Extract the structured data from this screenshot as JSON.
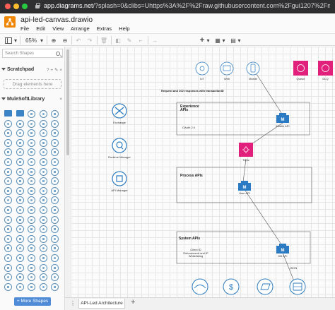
{
  "browser": {
    "url_host": "app.diagrams.net",
    "url_rest": "/?splash=0&clibs=Uhttps%3A%2F%2Fraw.githubusercontent.com%2Fgui1207%2Fmulesoft-draw.io%2Fmaster%2F"
  },
  "app": {
    "document_title": "api-led-canvas.drawio",
    "menu": [
      "File",
      "Edit",
      "View",
      "Arrange",
      "Extras",
      "Help"
    ]
  },
  "toolbar": {
    "zoom": "65%",
    "zoom_in": "⊕",
    "zoom_out": "⊖",
    "undo": "↶",
    "redo": "↷",
    "delete": "🗑",
    "fill": "◧",
    "line": "✎",
    "waypoints": "⌐",
    "connection": "→",
    "insert": "+",
    "table": "▦",
    "layout": "▤"
  },
  "sidebar": {
    "search_placeholder": "Search Shapes",
    "scratchpad_title": "Scratchpad",
    "scratchpad_controls": "? + ✎ ×",
    "drag_hint": "Drag elements here",
    "library_title": "MuleSoftLibrary",
    "library_controls": "×",
    "more_shapes": "+ More Shapes"
  },
  "pages": {
    "menu_glyph": "⋮",
    "active_page": "API-Led Architecture",
    "add_glyph": "+"
  },
  "diagram": {
    "top_icons": {
      "iot": "IoT",
      "web": "Web",
      "mobile": "Mobile",
      "queue": "Queue",
      "dlq": "DLQ"
    },
    "request_note": "Request and 202 responses with transactionID",
    "left_icons": {
      "exchange": "Exchange",
      "runtime_manager": "Runtime Manager",
      "api_manager": "API Manager"
    },
    "experience": {
      "title": "Experience APIs",
      "note": "OAuth 2.0",
      "api_label": "Mobile API"
    },
    "topic_label": "Topic",
    "process": {
      "title": "Process APIs",
      "api_label": "User API"
    },
    "system": {
      "title": "System APIs",
      "note": "Client ID Enforcement and IP Whitelisting",
      "api_label": "DB API"
    },
    "json_label": "JSON"
  },
  "colors": {
    "accent_pink": "#e0207a",
    "api_blue": "#2a7ac4",
    "icon_stroke": "#2d7bbf",
    "drawio_orange": "#f08705",
    "more_shapes_blue": "#4f8bd6"
  }
}
